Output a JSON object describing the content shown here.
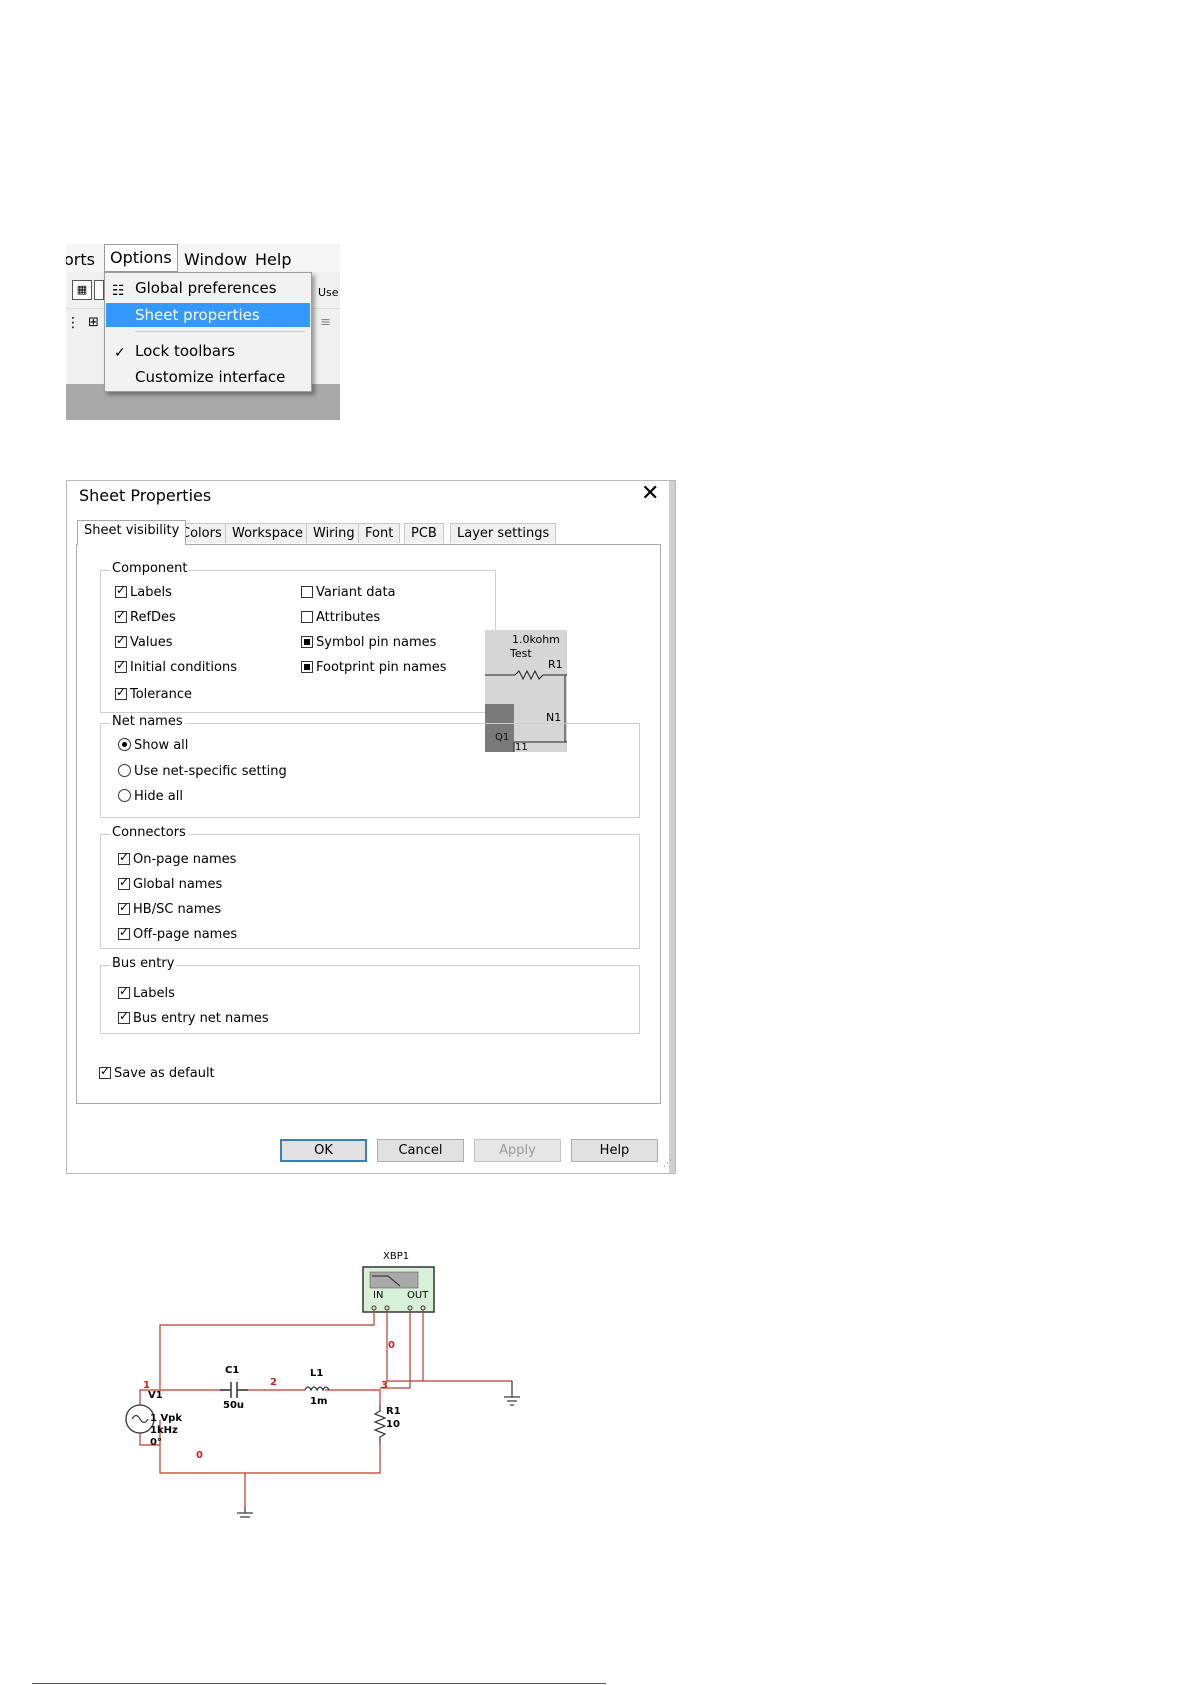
{
  "menu": {
    "bar_items": [
      {
        "label": "orts"
      },
      {
        "label": "Options"
      },
      {
        "label": "Window"
      },
      {
        "label": "Help"
      }
    ],
    "dropdown": [
      {
        "label": "Global preferences",
        "icon": "global-preferences-icon"
      },
      {
        "label": "Sheet properties",
        "highlighted": true
      },
      {
        "label": "Lock toolbars",
        "checked": true
      },
      {
        "label": "Customize interface"
      }
    ],
    "toolbar_fragment": "Use"
  },
  "dialog": {
    "title": "Sheet Properties",
    "tabs": [
      "Sheet visibility",
      "Colors",
      "Workspace",
      "Wiring",
      "Font",
      "PCB",
      "Layer settings"
    ],
    "active_tab": "Sheet visibility",
    "component": {
      "title": "Component",
      "left": [
        {
          "label": "Labels",
          "state": "checked"
        },
        {
          "label": "RefDes",
          "state": "checked"
        },
        {
          "label": "Values",
          "state": "checked"
        },
        {
          "label": "Initial conditions",
          "state": "checked"
        },
        {
          "label": "Tolerance",
          "state": "checked"
        }
      ],
      "right": [
        {
          "label": "Variant data",
          "state": "unchecked"
        },
        {
          "label": "Attributes",
          "state": "unchecked"
        },
        {
          "label": "Symbol pin names",
          "state": "indeterminate"
        },
        {
          "label": "Footprint pin names",
          "state": "indeterminate"
        }
      ]
    },
    "preview": {
      "line1": "1.0kohm",
      "line2": "Test",
      "r": "R1",
      "n": "N1",
      "q": "Q1",
      "pin": "11"
    },
    "net_names": {
      "title": "Net names",
      "options": [
        "Show all",
        "Use net-specific setting",
        "Hide all"
      ],
      "selected": "Show all"
    },
    "connectors": {
      "title": "Connectors",
      "items": [
        "On-page names",
        "Global names",
        "HB/SC names",
        "Off-page names"
      ]
    },
    "bus_entry": {
      "title": "Bus entry",
      "items": [
        "Labels",
        "Bus entry net names"
      ]
    },
    "save_default": "Save as default",
    "buttons": {
      "ok": "OK",
      "cancel": "Cancel",
      "apply": "Apply",
      "help": "Help"
    }
  },
  "circuit": {
    "bode_plotter": {
      "name": "XBP1",
      "in": "IN",
      "out": "OUT"
    },
    "source": {
      "name": "V1",
      "amplitude": "1 Vpk",
      "frequency": "1kHz",
      "phase": "0°"
    },
    "capacitor": {
      "name": "C1",
      "value": "50u"
    },
    "inductor": {
      "name": "L1",
      "value": "1m"
    },
    "resistor": {
      "name": "R1",
      "value": "10"
    },
    "nodes": [
      "1",
      "2",
      "3",
      "0",
      "0"
    ],
    "wire_color": "#c0392b"
  }
}
